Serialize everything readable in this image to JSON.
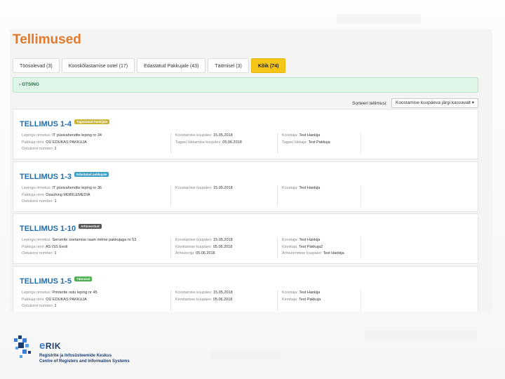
{
  "page_title": "Tellimused",
  "tabs": [
    {
      "label": "Töösolevad  (3)"
    },
    {
      "label": "Kooskõlastamise ootel  (17)"
    },
    {
      "label": "Edastatud Pakkujale  (43)"
    },
    {
      "label": "Täitmisel  (3)"
    },
    {
      "label": "Kõik (74)"
    }
  ],
  "search": {
    "label": "› OTSING"
  },
  "sort": {
    "label": "Sorteeri tellimusi:",
    "value": "Koostamise kuupäeva järgi kasvavalt ▾"
  },
  "orders": [
    {
      "title": "TELLIMUS 1-4",
      "badge": "Tagastatud hankijale",
      "badge_color": "#c9b53a",
      "c1": [
        {
          "label": "Lepingu nimetus:",
          "value": "IT püsivahendite leping nr 34"
        },
        {
          "label": "Pakkuja nimi:",
          "value": "OÜ EDUKAS PAKKUJA"
        },
        {
          "label": "Ostukorvi number:",
          "value": "1"
        }
      ],
      "c2": [
        {
          "label": "Koostamise kuupäev:",
          "value": "15.05.2018"
        },
        {
          "label": "Tagasi lükkamise kuupäev:",
          "value": "05.06.2018"
        }
      ],
      "c3": [
        {
          "label": "Koostaja:",
          "value": "Test Hankija"
        },
        {
          "label": "Tagasi lükkaja:",
          "value": "Test Pakkuja"
        }
      ]
    },
    {
      "title": "TELLIMUS 1-3",
      "badge": "Edastatud pakkujale",
      "badge_color": "#3a9fc4",
      "c1": [
        {
          "label": "Lepingu nimetus:",
          "value": "IT püsivahendite leping nr 36"
        },
        {
          "label": "Pakkuja nimi:",
          "value": "Osaühing MOBILEMEDIA"
        },
        {
          "label": "Ostukorvi number:",
          "value": "1"
        }
      ],
      "c2": [
        {
          "label": "Koostamise kuupäev:",
          "value": "15.05.2018"
        }
      ],
      "c3": [
        {
          "label": "Koostaja:",
          "value": "Test Hankija"
        }
      ]
    },
    {
      "title": "TELLIMUS 1-10",
      "badge": "Arhiveeritud",
      "badge_color": "#555555",
      "c1": [
        {
          "label": "Lepingu nimetus:",
          "value": "Serverite soetamise raam mitme pakkujaga nr 53"
        },
        {
          "label": "Pakkuja nimi:",
          "value": "AS ISS Eesti"
        },
        {
          "label": "Ostukorvi number:",
          "value": "1"
        }
      ],
      "c2": [
        {
          "label": "Koostamise kuupäev:",
          "value": "15.05.2018"
        },
        {
          "label": "Kinnitamise kuupäev:",
          "value": "05.06.2018"
        },
        {
          "label": "Arhiveerija:",
          "value": "05.06.2018"
        }
      ],
      "c3": [
        {
          "label": "Koostaja:",
          "value": "Test Hankija"
        },
        {
          "label": "Kinnitaja:",
          "value": "Test Pakkuja2"
        },
        {
          "label": "Arhiveerimise kuupäev:",
          "value": "Test Hankija"
        }
      ]
    },
    {
      "title": "TELLIMUS 1-5",
      "badge": "Täitmisel",
      "badge_color": "#4caf50",
      "c1": [
        {
          "label": "Lepingu nimetus:",
          "value": "Printerite ostu leping nr 45"
        },
        {
          "label": "Pakkuja nimi:",
          "value": "OÜ EDUKAS PAKKUJA"
        },
        {
          "label": "Ostukorvi number:",
          "value": "1"
        }
      ],
      "c2": [
        {
          "label": "Koostamise kuupäev:",
          "value": "15.05.2018"
        },
        {
          "label": "Kinnitamise kuupäev:",
          "value": "05.06.2018"
        }
      ],
      "c3": [
        {
          "label": "Koostaja:",
          "value": "Test Hankija"
        },
        {
          "label": "Kinnitaja:",
          "value": "Test Pakkuja"
        }
      ]
    }
  ],
  "footer": {
    "logo_text": "RIK",
    "line1": "Registrite ja Infosüsteemide Keskus",
    "line2": "Centre of Registers and Information Systems"
  },
  "colors": {
    "title": "#e07a2d",
    "active_tab": "#f5c518",
    "link": "#1f6fb0",
    "search_bg": "#dff5e8"
  }
}
